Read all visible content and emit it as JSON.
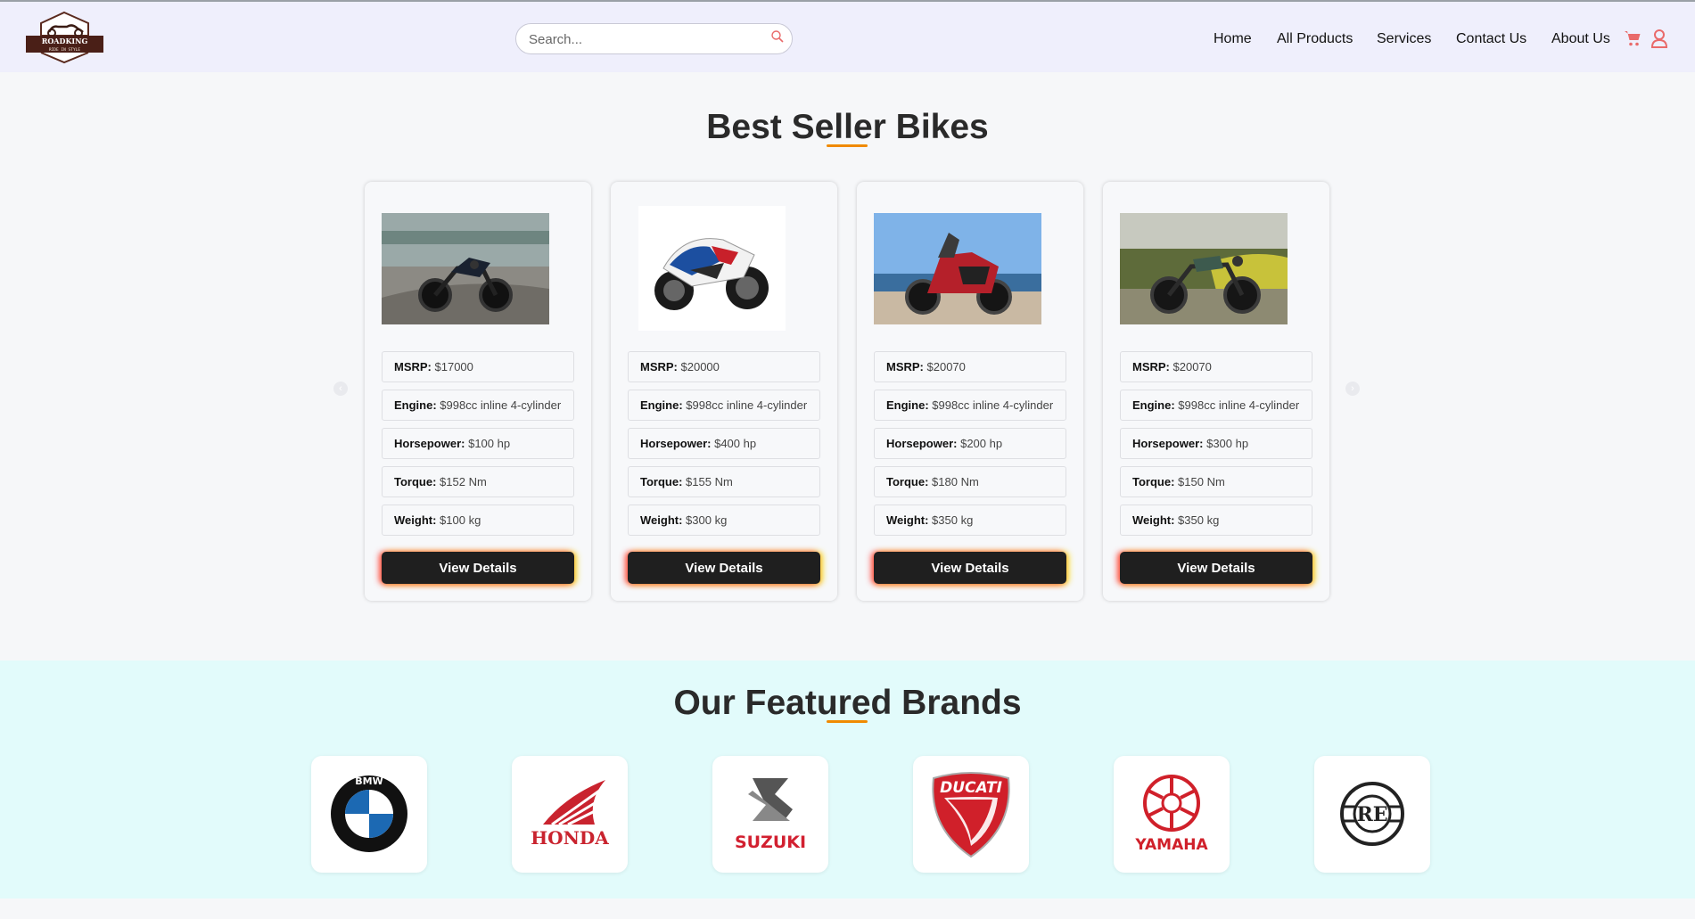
{
  "header": {
    "logo_text": "ROADKING",
    "logo_tagline": "RIDE IN STYLE",
    "search_placeholder": "Search...",
    "nav": [
      "Home",
      "All Products",
      "Services",
      "Contact Us",
      "About Us"
    ]
  },
  "best_sellers": {
    "title": "Best Seller Bikes",
    "labels": {
      "msrp": "MSRP:",
      "engine": "Engine:",
      "horsepower": "Horsepower:",
      "torque": "Torque:",
      "weight": "Weight:"
    },
    "button_label": "View Details",
    "cards": [
      {
        "msrp": "$17000",
        "engine": "$998cc inline 4-cylinder",
        "horsepower": "$100 hp",
        "torque": "$152 Nm",
        "weight": "$100 kg"
      },
      {
        "msrp": "$20000",
        "engine": "$998cc inline 4-cylinder",
        "horsepower": "$400 hp",
        "torque": "$155 Nm",
        "weight": "$300 kg"
      },
      {
        "msrp": "$20070",
        "engine": "$998cc inline 4-cylinder",
        "horsepower": "$200 hp",
        "torque": "$180 Nm",
        "weight": "$350 kg"
      },
      {
        "msrp": "$20070",
        "engine": "$998cc inline 4-cylinder",
        "horsepower": "$300 hp",
        "torque": "$150 Nm",
        "weight": "$350 kg"
      }
    ]
  },
  "brands": {
    "title": "Our Featured Brands",
    "items": [
      "BMW",
      "HONDA",
      "SUZUKI",
      "DUCATI",
      "YAMAHA",
      "RE"
    ]
  },
  "colors": {
    "accent": "#f08a00",
    "nav_icon": "#e96a6a",
    "button": "#1f1f1f",
    "brand_band": "#e2fbfb"
  }
}
